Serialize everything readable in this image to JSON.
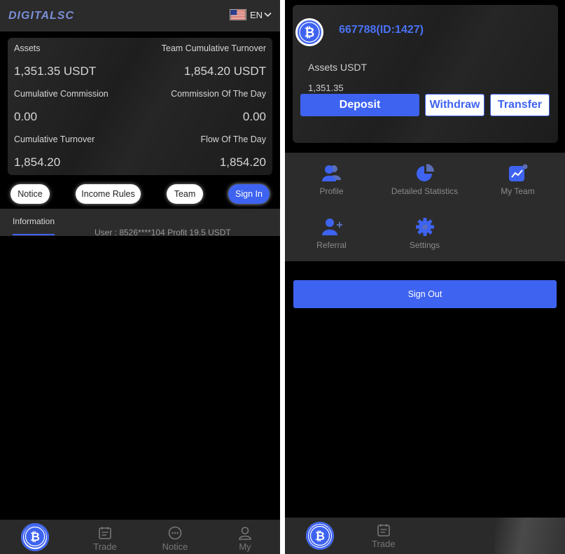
{
  "left": {
    "brand": "DIGITALSC",
    "language": "EN",
    "assets_card": {
      "assets_label": "Assets",
      "assets_value": "1,351.35 USDT",
      "team_turnover_label": "Team Cumulative Turnover",
      "team_turnover_value": "1,854.20 USDT",
      "cum_commission_label": "Cumulative Commission",
      "cum_commission_value": "0.00",
      "day_commission_label": "Commission Of The Day",
      "day_commission_value": "0.00",
      "cum_turnover_label": "Cumulative Turnover",
      "cum_turnover_value": "1,854.20",
      "day_flow_label": "Flow Of The Day",
      "day_flow_value": "1,854.20"
    },
    "pills": [
      "Notice",
      "Income Rules",
      "Team",
      "Sign In"
    ],
    "info_tab": "Information",
    "ticker": "User : 8526****104 Profit 19.5 USDT",
    "nav": [
      "Trade",
      "Notice",
      "My"
    ]
  },
  "right": {
    "user_id": "667788(ID:1427)",
    "assets_label": "Assets USDT",
    "assets_value": "1,351.35",
    "deposit": "Deposit",
    "withdraw": "Withdraw",
    "transfer": "Transfer",
    "menu": [
      "Profile",
      "Detailed Statistics",
      "My Team",
      "Referral",
      "Settings"
    ],
    "sign_out": "Sign Out",
    "nav": [
      "Trade"
    ]
  },
  "colors": {
    "accent": "#3e63f0",
    "link_blue": "#4a72f5",
    "background": "#000000",
    "surface": "#2c2c2c"
  },
  "icons": [
    "bitcoin-icon",
    "us-flag-icon",
    "chevron-down-icon",
    "trade-icon",
    "chat-icon",
    "user-icon",
    "profile-icon",
    "pie-chart-icon",
    "team-chart-icon",
    "add-user-icon",
    "gear-icon"
  ]
}
